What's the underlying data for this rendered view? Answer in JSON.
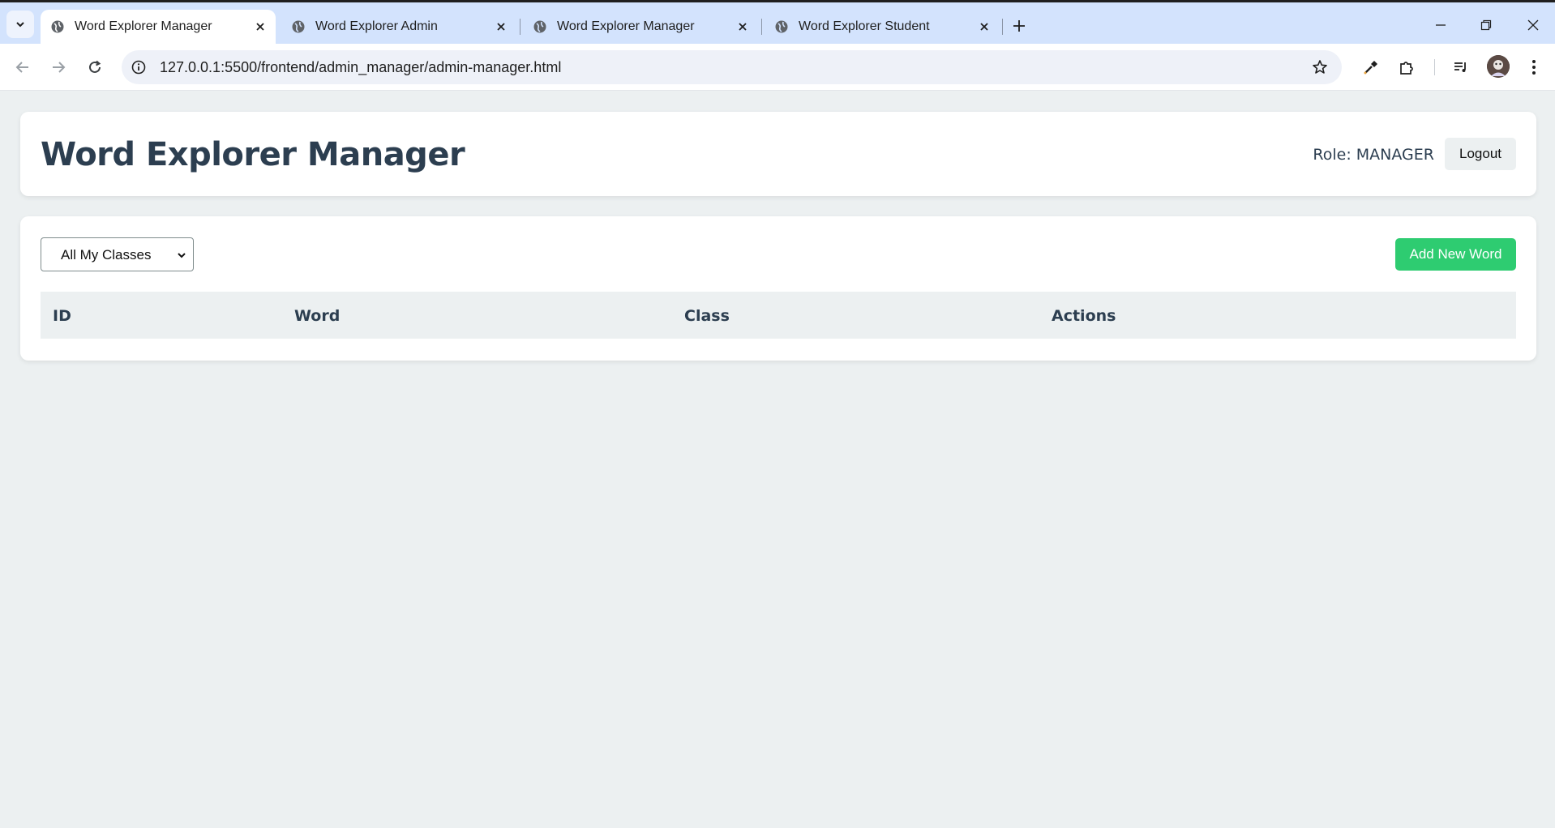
{
  "browser": {
    "tabs": [
      {
        "title": "Word Explorer Manager",
        "active": true
      },
      {
        "title": "Word Explorer Admin",
        "active": false
      },
      {
        "title": "Word Explorer Manager",
        "active": false
      },
      {
        "title": "Word Explorer Student",
        "active": false
      }
    ],
    "url": "127.0.0.1:5500/frontend/admin_manager/admin-manager.html"
  },
  "header": {
    "title": "Word Explorer Manager",
    "role_text": "Role: MANAGER",
    "logout_label": "Logout"
  },
  "controls": {
    "class_filter_selected": "All My Classes",
    "add_word_label": "Add New Word"
  },
  "table": {
    "columns": [
      "ID",
      "Word",
      "Class",
      "Actions"
    ],
    "rows": []
  },
  "colors": {
    "accent_green": "#2ecc71",
    "heading": "#2c3e50",
    "background": "#ecf0f1"
  }
}
